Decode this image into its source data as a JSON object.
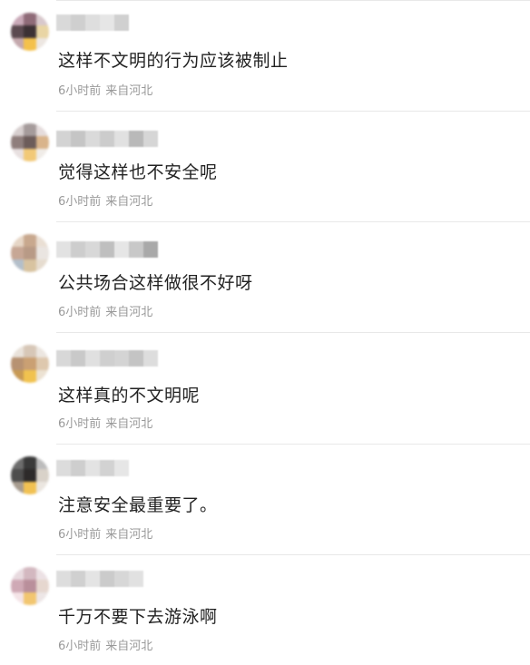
{
  "comments": [
    {
      "text": "这样不文明的行为应该被制止",
      "time": "6小时前",
      "location": "来自河北",
      "avatar_colors": [
        "#c9a9b8",
        "#8f6b78",
        "#d8c8cc",
        "#5b4a50",
        "#3c3134",
        "#e9d5a4",
        "#c4a8ad",
        "#f4c14c",
        "#ede7e2"
      ]
    },
    {
      "text": "觉得这样也不安全呢",
      "time": "6小时前",
      "location": "来自河北",
      "avatar_colors": [
        "#d7cfcf",
        "#a59b9b",
        "#e5dcdc",
        "#8f7e7c",
        "#6c5c5a",
        "#d9b48b",
        "#e8e0e0",
        "#f2c977",
        "#f0ece8"
      ]
    },
    {
      "text": "公共场合这样做很不好呀",
      "time": "6小时前",
      "location": "来自河北",
      "avatar_colors": [
        "#e6d6c6",
        "#c8a88e",
        "#eadfd4",
        "#c7a795",
        "#b89a86",
        "#eae5e1",
        "#b4bfca",
        "#d8c3a0",
        "#e6dccf"
      ]
    },
    {
      "text": "这样真的不文明呢",
      "time": "6小时前",
      "location": "来自河北",
      "avatar_colors": [
        "#e9e2da",
        "#d7c7b7",
        "#ece6e0",
        "#b79272",
        "#caa073",
        "#dec8ae",
        "#c89a54",
        "#f1c24f",
        "#ece2d3"
      ]
    },
    {
      "text": "注意安全最重要了。",
      "time": "6小时前",
      "location": "来自河北",
      "avatar_colors": [
        "#6d6d6d",
        "#3a3a3a",
        "#bcbcbc",
        "#4d4d4d",
        "#2d2a2a",
        "#d9d2c9",
        "#a79c8f",
        "#f1c152",
        "#ebe6e0"
      ]
    },
    {
      "text": "千万不要下去游泳啊",
      "time": "6小时前",
      "location": "来自河北",
      "avatar_colors": [
        "#e8dadf",
        "#d3b8c0",
        "#ece1e4",
        "#cfa9b5",
        "#b98f9b",
        "#e6d7cf",
        "#f4e4e7",
        "#f2c670",
        "#ede6e6"
      ]
    }
  ],
  "username_blocks": [
    [
      "#d9d9d9",
      "#cfcfcf",
      "#dedede",
      "#e6e6e6",
      "#d0d0d0"
    ],
    [
      "#d3d3d3",
      "#c5c5c5",
      "#dadada",
      "#cccccc",
      "#e1e1e1",
      "#b9b9b9",
      "#d6d6d6"
    ],
    [
      "#e2e2e2",
      "#cdcdcd",
      "#d8d8d8",
      "#bfbfbf",
      "#e6e6e6",
      "#c8c8c8",
      "#a9a9a9"
    ],
    [
      "#d8d8d8",
      "#c9c9c9",
      "#e0e0e0",
      "#cfcfcf",
      "#d4d4d4",
      "#c4c4c4",
      "#dddddd"
    ],
    [
      "#dcdcdc",
      "#cecece",
      "#e3e3e3",
      "#d2d2d2",
      "#e6e6e6"
    ],
    [
      "#dddddd",
      "#d0d0d0",
      "#e4e4e4",
      "#cbcbcb",
      "#d7d7d7",
      "#e1e1e1"
    ]
  ]
}
